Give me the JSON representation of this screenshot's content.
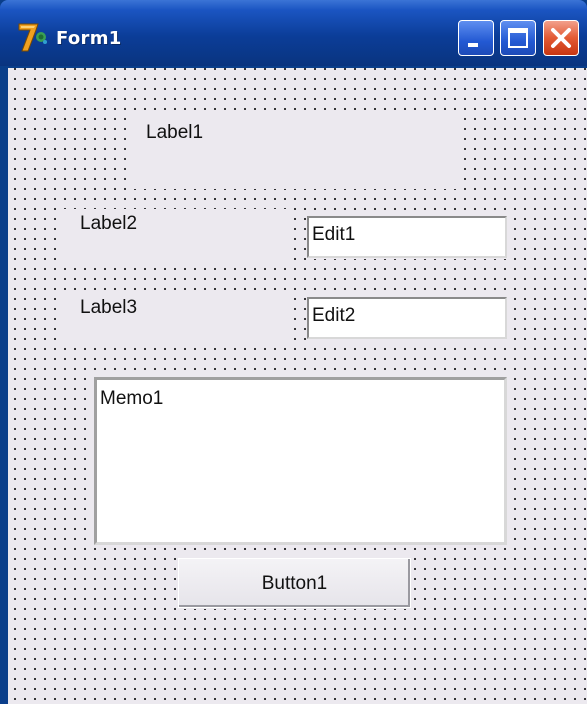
{
  "window": {
    "title": "Form1",
    "icon": "delphi-app-icon",
    "controls": [
      "minimize-icon",
      "maximize-icon",
      "close-icon"
    ]
  },
  "form": {
    "label1": "Label1",
    "label2": "Label2",
    "label3": "Label3",
    "edit1": "Edit1",
    "edit2": "Edit2",
    "memo1": "Memo1",
    "button1": "Button1"
  },
  "colors": {
    "title_bar": "#0a3e8a",
    "form_background": "#ece9ef",
    "close_button": "#e35a33"
  }
}
